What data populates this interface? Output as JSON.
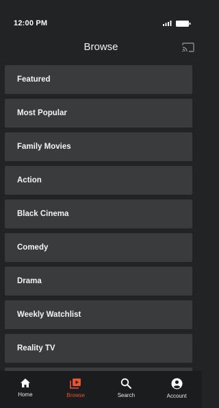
{
  "status_bar": {
    "time": "12:00 PM",
    "icons": [
      "signal-icon",
      "battery-icon"
    ]
  },
  "header": {
    "title": "Browse",
    "cast_icon": "cast-icon"
  },
  "categories": [
    {
      "label": "Featured"
    },
    {
      "label": "Most Popular"
    },
    {
      "label": "Family Movies"
    },
    {
      "label": "Action"
    },
    {
      "label": "Black Cinema"
    },
    {
      "label": "Comedy"
    },
    {
      "label": "Drama"
    },
    {
      "label": "Weekly Watchlist"
    },
    {
      "label": "Reality TV"
    }
  ],
  "bottom_nav": {
    "items": [
      {
        "label": "Home",
        "icon": "home-icon",
        "active": false
      },
      {
        "label": "Browse",
        "icon": "browse-icon",
        "active": true
      },
      {
        "label": "Search",
        "icon": "search-icon",
        "active": false
      },
      {
        "label": "Account",
        "icon": "account-icon",
        "active": false
      }
    ]
  },
  "colors": {
    "background": "#222325",
    "item_background": "#3a3b3d",
    "accent": "#e8542b",
    "nav_background": "#1b1c1e"
  }
}
